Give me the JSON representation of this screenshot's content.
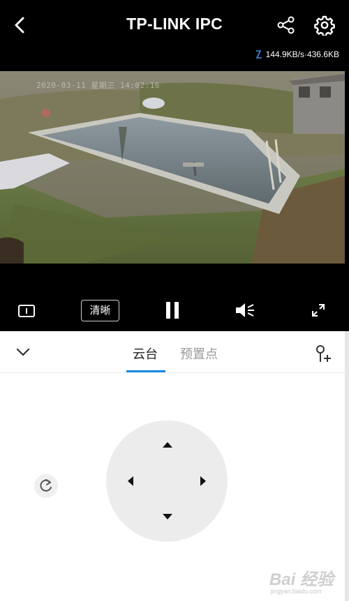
{
  "header": {
    "title": "TP-LINK IPC",
    "speed": "144.9KB/s·436.6KB"
  },
  "video": {
    "osd_timestamp": "2020-03-11 星期三 14:02:16"
  },
  "controls": {
    "quality_label": "清晰"
  },
  "panel": {
    "tabs": [
      {
        "label": "云台",
        "active": true
      },
      {
        "label": "预置点",
        "active": false
      }
    ]
  },
  "watermark": {
    "text": "Bai 经验",
    "sub": "jingyan.baidu.com"
  },
  "colors": {
    "accent": "#1a8ae0",
    "speed_icon": "#3d8fe8"
  }
}
